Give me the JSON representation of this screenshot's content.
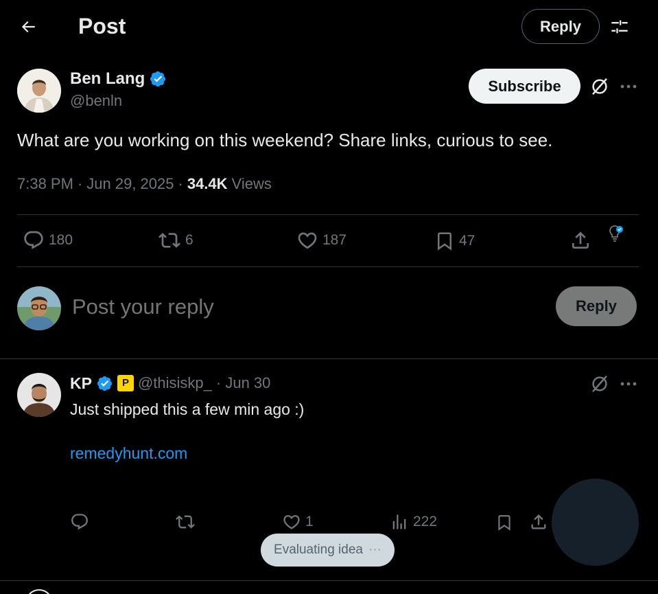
{
  "header": {
    "title": "Post",
    "reply_label": "Reply"
  },
  "post": {
    "author_name": "Ben Lang",
    "author_handle": "@benln",
    "subscribe_label": "Subscribe",
    "text": "What are you working on this weekend? Share links, curious to see.",
    "time": "7:38 PM",
    "date": "Jun 29, 2025",
    "views_count": "34.4K",
    "views_label": "Views",
    "stats": {
      "replies": "180",
      "reposts": "6",
      "likes": "187",
      "bookmarks": "47"
    }
  },
  "composer": {
    "placeholder": "Post your reply",
    "submit_label": "Reply"
  },
  "reply": {
    "author_name": "KP",
    "badge_letter": "P",
    "author_handle": "@thisiskp_",
    "date": "· Jun 30",
    "text": "Just shipped this a few min ago :)",
    "link": "remedyhunt.com",
    "stats": {
      "likes": "1",
      "views": "222"
    }
  },
  "toast": {
    "text": "Evaluating idea",
    "dots": "···"
  },
  "colors": {
    "background": "#000000",
    "text_primary": "#e7e9ea",
    "text_secondary": "#71767b",
    "accent": "#1d9bf0",
    "divider": "#2f3336"
  },
  "icons": {
    "back": "arrow-left-icon",
    "filter": "sliders-icon",
    "verified": "verified-badge-icon",
    "grok": "grok-icon",
    "more": "more-horizontal-icon",
    "reply": "comment-icon",
    "repost": "repost-icon",
    "like": "heart-icon",
    "bookmark": "bookmark-icon",
    "share": "share-icon",
    "analytics": "bar-chart-icon",
    "lightbulb": "lightbulb-icon"
  }
}
